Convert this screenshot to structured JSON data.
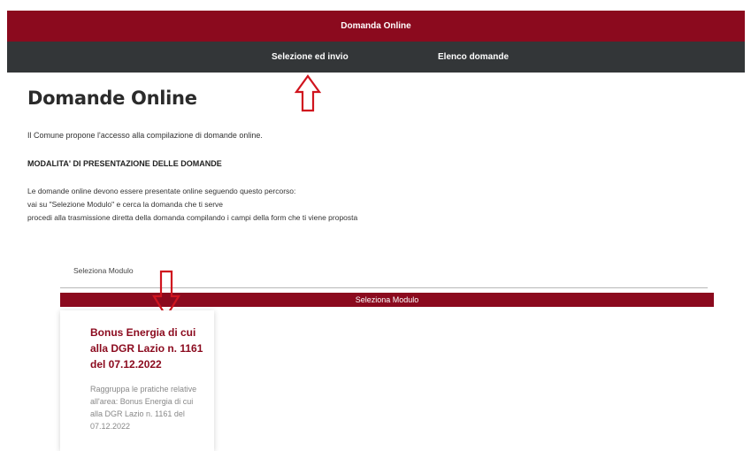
{
  "header": {
    "title": "Domanda Online"
  },
  "nav": {
    "items": [
      "Selezione ed invio",
      "Elenco domande"
    ]
  },
  "main": {
    "title": "Domande Online",
    "intro": "Il Comune propone l'accesso alla compilazione di domande online.",
    "section_heading": "MODALITA' DI PRESENTAZIONE DELLE DOMANDE",
    "description_lines": [
      "Le domande online devono essere presentate online seguendo questo percorso:",
      "vai su \"Selezione Modulo\" e cerca la domanda che ti serve",
      "procedi alla trasmissione diretta della domanda compilando i campi della form che ti viene proposta"
    ]
  },
  "module_select": {
    "label": "Seleziona Modulo",
    "bar_label": "Seleziona Modulo"
  },
  "card": {
    "title": "Bonus Energia di cui alla DGR Lazio n. 1161 del 07.12.2022",
    "description": "Raggruppa le pratiche relative all'area: Bonus Energia di cui alla DGR Lazio n. 1161 del 07.12.2022"
  },
  "colors": {
    "brand": "#8b0a1e",
    "nav_bg": "#333638",
    "annotation_arrow": "#d0141e"
  }
}
